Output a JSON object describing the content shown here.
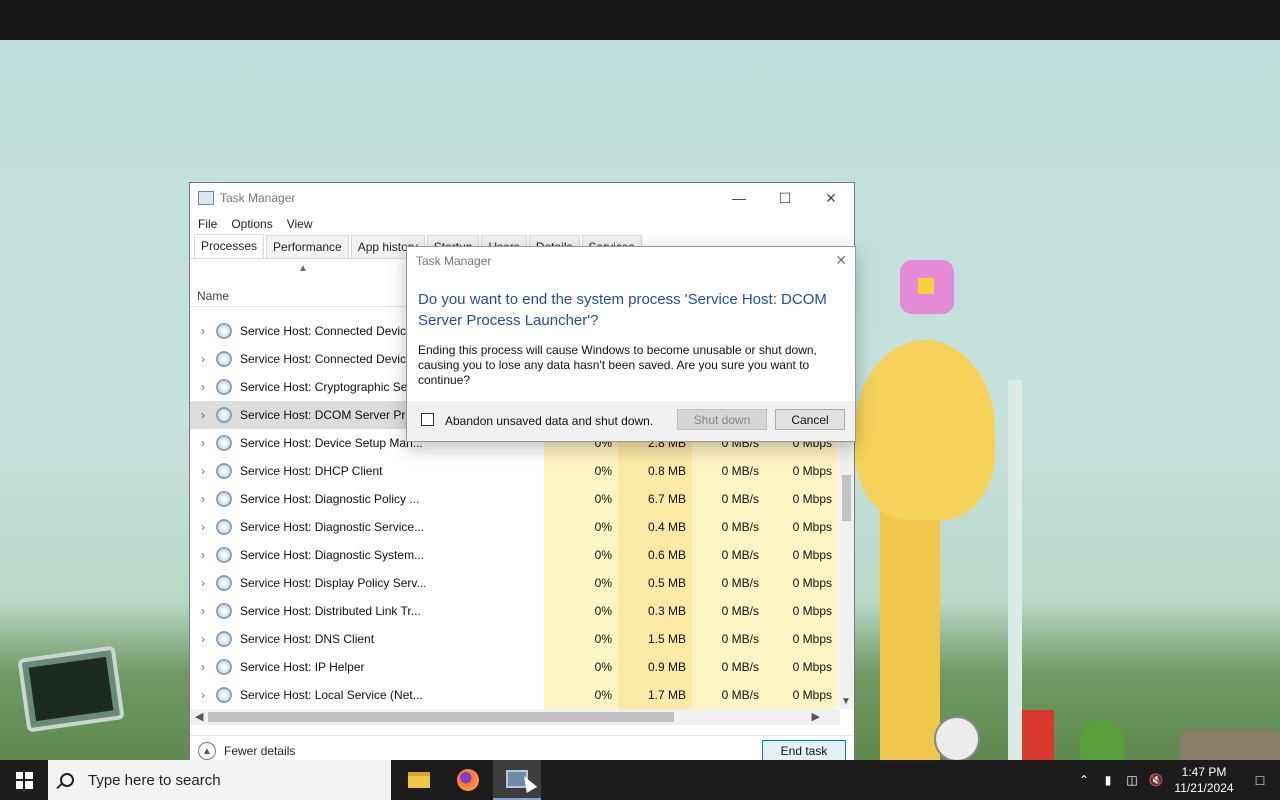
{
  "taskmanager": {
    "title": "Task Manager",
    "menu": [
      "File",
      "Options",
      "View"
    ],
    "tabs": [
      "Processes",
      "Performance",
      "App history",
      "Startup",
      "Users",
      "Details",
      "Services"
    ],
    "name_header": "Name",
    "processes": [
      {
        "name": "Service Host: Connected Devices...",
        "cpu": "",
        "mem": "",
        "disk": "",
        "net": ""
      },
      {
        "name": "Service Host: Connected Devices...",
        "cpu": "",
        "mem": "",
        "disk": "",
        "net": ""
      },
      {
        "name": "Service Host: Cryptographic Serv...",
        "cpu": "",
        "mem": "",
        "disk": "",
        "net": ""
      },
      {
        "name": "Service Host: DCOM Server Proc...",
        "cpu": "",
        "mem": "",
        "disk": "",
        "net": ""
      },
      {
        "name": "Service Host: Device Setup Man...",
        "cpu": "0%",
        "mem": "2.8 MB",
        "disk": "0 MB/s",
        "net": "0 Mbps"
      },
      {
        "name": "Service Host: DHCP Client",
        "cpu": "0%",
        "mem": "0.8 MB",
        "disk": "0 MB/s",
        "net": "0 Mbps"
      },
      {
        "name": "Service Host: Diagnostic Policy ...",
        "cpu": "0%",
        "mem": "6.7 MB",
        "disk": "0 MB/s",
        "net": "0 Mbps"
      },
      {
        "name": "Service Host: Diagnostic Service...",
        "cpu": "0%",
        "mem": "0.4 MB",
        "disk": "0 MB/s",
        "net": "0 Mbps"
      },
      {
        "name": "Service Host: Diagnostic System...",
        "cpu": "0%",
        "mem": "0.6 MB",
        "disk": "0 MB/s",
        "net": "0 Mbps"
      },
      {
        "name": "Service Host: Display Policy Serv...",
        "cpu": "0%",
        "mem": "0.5 MB",
        "disk": "0 MB/s",
        "net": "0 Mbps"
      },
      {
        "name": "Service Host: Distributed Link Tr...",
        "cpu": "0%",
        "mem": "0.3 MB",
        "disk": "0 MB/s",
        "net": "0 Mbps"
      },
      {
        "name": "Service Host: DNS Client",
        "cpu": "0%",
        "mem": "1.5 MB",
        "disk": "0 MB/s",
        "net": "0 Mbps"
      },
      {
        "name": "Service Host: IP Helper",
        "cpu": "0%",
        "mem": "0.9 MB",
        "disk": "0 MB/s",
        "net": "0 Mbps"
      },
      {
        "name": "Service Host: Local Service (Net...",
        "cpu": "0%",
        "mem": "1.7 MB",
        "disk": "0 MB/s",
        "net": "0 Mbps"
      }
    ],
    "fewer_details": "Fewer details",
    "end_task": "End task"
  },
  "dialog": {
    "title": "Task Manager",
    "question": "Do you want to end the system process 'Service Host: DCOM Server Process Launcher'?",
    "message": "Ending this process will cause Windows to become unusable or shut down, causing you to lose any data hasn't been saved. Are you sure you want to continue?",
    "checkbox_label": "Abandon unsaved data and shut down.",
    "shutdown": "Shut down",
    "cancel": "Cancel"
  },
  "taskbar": {
    "search_placeholder": "Type here to search",
    "time": "1:47 PM",
    "date": "11/21/2024"
  }
}
